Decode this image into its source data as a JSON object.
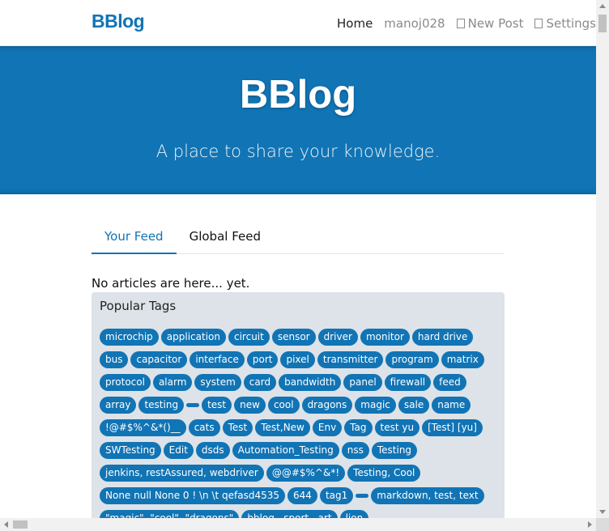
{
  "navbar": {
    "brand": "BBlog",
    "items": [
      {
        "label": "Home",
        "icon": "",
        "active": true
      },
      {
        "label": "manoj028",
        "icon": "",
        "active": false
      },
      {
        "label": "New Post",
        "icon": "edit-icon",
        "active": false
      },
      {
        "label": "Settings",
        "icon": "gear-icon",
        "active": false
      }
    ]
  },
  "banner": {
    "title": "BBlog",
    "subtitle": "A place to share your knowledge."
  },
  "tabs": [
    {
      "label": "Your Feed",
      "active": true
    },
    {
      "label": "Global Feed",
      "active": false
    }
  ],
  "feed": {
    "empty_message": "No articles are here... yet."
  },
  "sidebar": {
    "title": "Popular Tags",
    "tags": [
      "microchip",
      "application",
      "circuit",
      "sensor",
      "driver",
      "monitor",
      "hard drive",
      "bus",
      "capacitor",
      "interface",
      "port",
      "pixel",
      "transmitter",
      "program",
      "matrix",
      "protocol",
      "alarm",
      "system",
      "card",
      "bandwidth",
      "panel",
      "firewall",
      "feed",
      "array",
      "testing",
      "",
      "test",
      "new",
      "cool",
      "dragons",
      "magic",
      "sale",
      "name",
      "!@#$%^&*()__",
      "cats",
      "Test",
      "Test,New",
      "Env",
      "Tag",
      "test yu",
      "[Test] [yu]",
      "SWTesting",
      "Edit",
      "dsds",
      "Automation_Testing",
      "nss",
      "Testing",
      "jenkins, restAssured, webdriver",
      "@@#$%^&*!",
      "Testing, Cool",
      "None null None 0 ! \\n \\t qefasd4535",
      "644",
      "tag1",
      "",
      "markdown, test, text",
      "\"magic\", \"cool\", \"dragons\"",
      "bblog , sport , art",
      "lion"
    ]
  },
  "colors": {
    "primary": "#1174b5",
    "sidebar_bg": "#dde3e8"
  }
}
